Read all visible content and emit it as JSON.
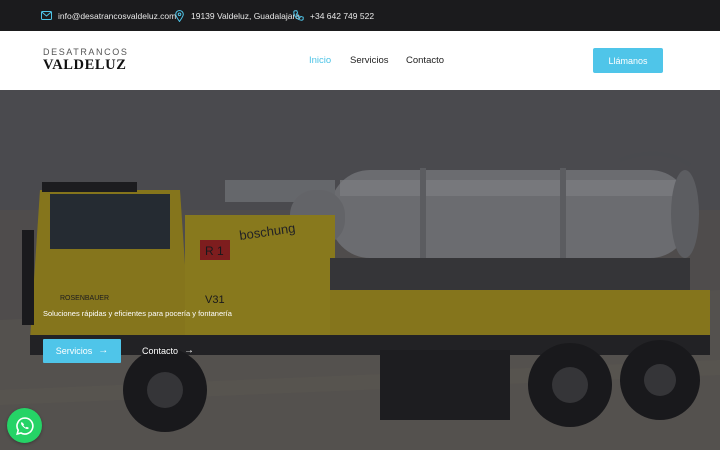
{
  "topbar": {
    "email": "info@desatrancosvaldeluz.com",
    "address": "19139 Valdeluz, Guadalajara",
    "phone": "+34 642 749 522",
    "icons": [
      "mail-icon",
      "map-pin-icon",
      "phone-icon"
    ]
  },
  "brand": {
    "top": "DESATRANCOS",
    "main": "VALDELUZ"
  },
  "nav": {
    "items": [
      {
        "label": "Inicio",
        "active": true
      },
      {
        "label": "Servicios",
        "active": false
      },
      {
        "label": "Contacto",
        "active": false
      }
    ],
    "call_label": "Llámanos"
  },
  "hero": {
    "tagline": "Soluciones rápidas y eficientes para pocería y fontanería",
    "primary_label": "Servicios",
    "secondary_label": "Contacto",
    "truck_text": {
      "r1": "R 1",
      "brand": "boschung",
      "number": "V31",
      "text_left": "ROSENBAUER"
    }
  },
  "floating": {
    "whatsapp_icon": "whatsapp-icon"
  },
  "colors": {
    "accent": "#4fc5e9",
    "topbar": "#1b1b1d",
    "truck_yellow": "#d9bf1c"
  }
}
